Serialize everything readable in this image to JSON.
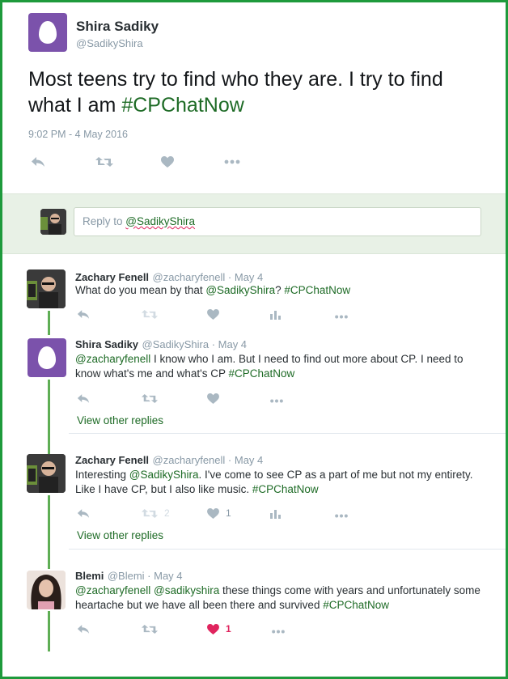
{
  "main_tweet": {
    "name": "Shira Sadiky",
    "handle": "@SadikyShira",
    "text_plain": "Most teens try to find who they are. I try to find what I am ",
    "hashtag": "#CPChatNow",
    "timestamp": "9:02 PM - 4 May 2016"
  },
  "reply_box": {
    "prefix": "Reply to ",
    "mention": "@SadikyShira"
  },
  "replies": [
    {
      "name": "Zachary Fenell",
      "handle": "@zacharyfenell",
      "date": "May 4",
      "text_1": "What do you mean by that ",
      "mention": "@SadikyShira",
      "text_2": "? ",
      "hashtag": "#CPChatNow",
      "retweets": "",
      "likes": ""
    },
    {
      "name": "Shira Sadiky",
      "handle": "@SadikyShira",
      "date": "May 4",
      "mention": "@zacharyfenell",
      "text_1": " I know who I am. But I need to find out more about CP. I need to know what's me and what's CP ",
      "hashtag": "#CPChatNow",
      "view_replies": "View other replies"
    },
    {
      "name": "Zachary Fenell",
      "handle": "@zacharyfenell",
      "date": "May 4",
      "text_1": "Interesting ",
      "mention": "@SadikyShira",
      "text_2": ". I've come to see CP as a part of me but not my entirety. Like I have CP, but I also like music. ",
      "hashtag": "#CPChatNow",
      "retweets": "2",
      "likes": "1",
      "view_replies": "View other replies"
    },
    {
      "name": "Blemi",
      "handle": "@Blemi",
      "date": "May 4",
      "mention_1": "@zacharyfenell",
      "mention_2": "@sadikyshira",
      "text_1": " these things come with years and unfortunately some heartache but we have all been there and survived ",
      "hashtag": "#CPChatNow",
      "likes": "1"
    }
  ],
  "separator": " · ",
  "colors": {
    "accent_green": "#1e6b26",
    "frame_green": "#1e9a3c",
    "like_red": "#e0245e",
    "egg_purple": "#7b52ab"
  }
}
